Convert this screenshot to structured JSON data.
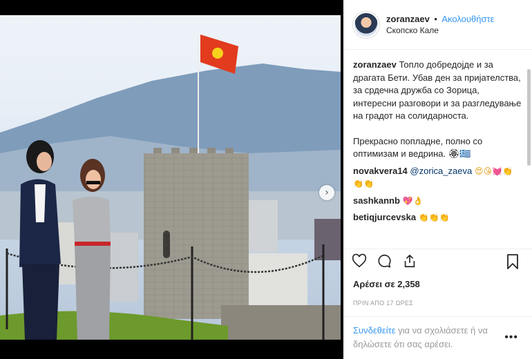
{
  "post": {
    "username": "zoranzaev",
    "separator": "•",
    "follow_label": "Ακολουθήστε",
    "location": "Скопско Кале",
    "caption_username": "zoranzaev",
    "caption_text": "Топло добредојде и за драгата Бети. Убав ден за пријателства, за срдечна дружба со Зорица, интересни разговори и за разгледување на градот на солидарноста.",
    "caption_text_2": "Прекрасно попладне, полно со оптимизам и ведрина. 🏵🇬🇷",
    "likes": "Αρέσει σε 2,358",
    "time": "ΠΡΙΝ ΑΠΟ 17 ΩΡΕΣ",
    "footer_login": "Συνδεθείτε",
    "footer_text": " για να σχολιάσετε ή να δηλώσετε ότι σας αρέσει.",
    "more": "•••",
    "next_arrow": "›"
  },
  "comments": [
    {
      "user": "novakvera14",
      "mention": "@zorica_zaeva",
      "text": " 😍😘💓👏👏👏"
    },
    {
      "user": "sashkannb",
      "mention": "",
      "text": " 💖👌"
    },
    {
      "user": "betiqjurcevska",
      "mention": "",
      "text": " 👏👏👏"
    }
  ],
  "icons": {
    "like": "heart-icon",
    "comment": "comment-icon",
    "share": "share-icon",
    "save": "bookmark-icon"
  },
  "colors": {
    "link": "#3897f0",
    "text": "#262626",
    "muted": "#999999"
  }
}
